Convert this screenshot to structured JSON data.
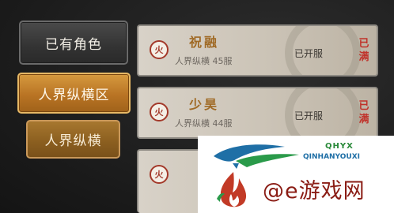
{
  "tabs": {
    "owned_roles": "已有角色",
    "region": "人界纵横区",
    "subregion": "人界纵横"
  },
  "servers": [
    {
      "element_icon": "火",
      "name": "祝融",
      "subtitle": "人界纵横 45服",
      "status": "已开服",
      "full_line1": "已",
      "full_line2": "满"
    },
    {
      "element_icon": "火",
      "name": "少昊",
      "subtitle": "人界纵横 44服",
      "status": "已开服",
      "full_line1": "已",
      "full_line2": "满"
    },
    {
      "element_icon": "火",
      "name": "",
      "subtitle": "",
      "status": "",
      "full_line1": "",
      "full_line2": ""
    }
  ],
  "watermark": {
    "brand_letters": "QHYX",
    "brand_domain": "QINHANYOUXI",
    "site_text": "@e游戏网"
  },
  "colors": {
    "gold_tab": "#b97424",
    "server_name": "#a06a25",
    "full_badge": "#c0322a"
  }
}
